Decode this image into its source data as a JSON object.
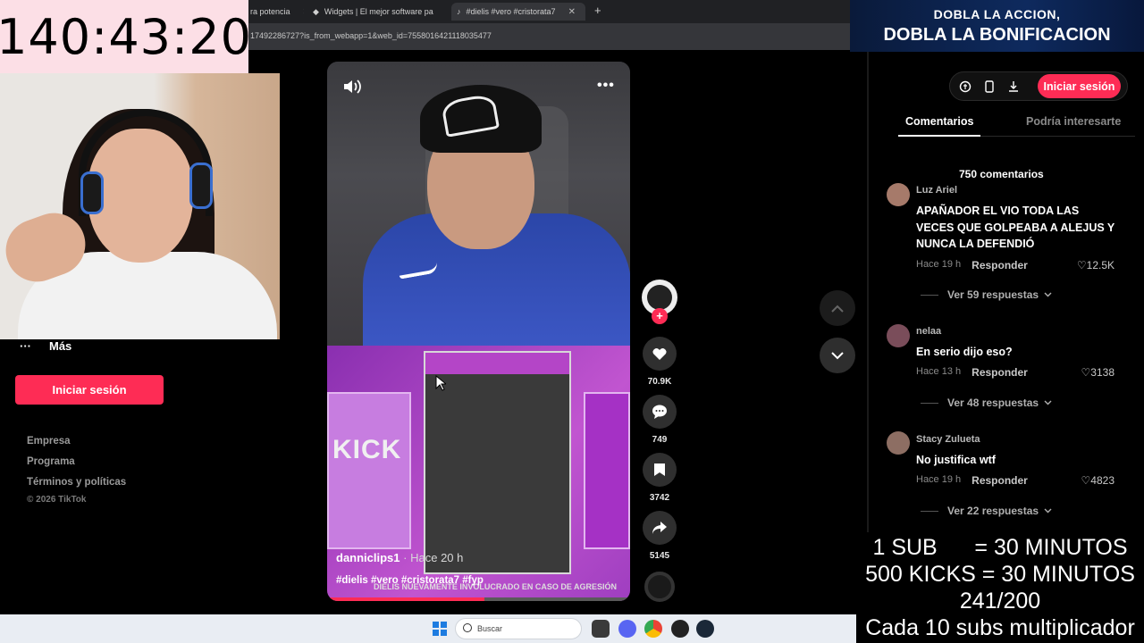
{
  "browser": {
    "tabs": [
      {
        "title": "ra potencia"
      },
      {
        "title": "Widgets | El mejor software pa"
      },
      {
        "title": "#dielis #vero #cristorata7"
      }
    ],
    "url": "17492286727?is_from_webapp=1&web_id=7558016421118035477"
  },
  "overlay": {
    "timer": "140:43:20",
    "promo_line1": "DOBLA LA ACCION,",
    "promo_line2": "DOBLA LA BONIFICACION",
    "subs_lines": [
      "1 SUB      = 30 MINUTOS",
      "500 KICKS = 30 MINUTOS",
      "241/200",
      "Cada 10 subs multiplicador"
    ]
  },
  "sidebar": {
    "more_icon": "···",
    "more_label": "Más",
    "login_label": "Iniciar sesión",
    "footer_links": [
      "Empresa",
      "Programa",
      "Términos y políticas"
    ],
    "copyright": "© 2026 TikTok"
  },
  "video": {
    "author": "danniclips1",
    "posted": "Hace 20 h",
    "hashtags": "#dielis #vero #cristorata7 #fyp",
    "banner": "DIELIS NUEVAMENTE INVOLUCRADO EN CASO DE AGRESIÓN",
    "kick_text": "KICK",
    "progress": 0.52,
    "likes": "70.9K",
    "comments": "749",
    "saves": "3742",
    "shares": "5145",
    "icons": {
      "volume": "speaker-icon",
      "more": "more-dots-icon"
    }
  },
  "right_panel": {
    "login_label": "Iniciar sesión",
    "tabs": [
      "Comentarios",
      "Podría interesarte"
    ],
    "comment_count": "750 comentarios",
    "reply_label": "Responder",
    "comments": [
      {
        "user": "Luz Ariel",
        "text": "APAÑADOR EL VIO TODA LAS VECES QUE GOLPEABA A ALEJUS Y NUNCA LA DEFENDIÓ",
        "time": "Hace 19 h",
        "likes": "12.5K",
        "more": "Ver 59 respuestas",
        "avatar_color": "#a67a6a"
      },
      {
        "user": "nelaa",
        "text": "En serio dijo eso?",
        "time": "Hace 13 h",
        "likes": "3138",
        "more": "Ver 48 respuestas",
        "avatar_color": "#7a4d5a"
      },
      {
        "user": "Stacy Zulueta",
        "text": "No justifica wtf",
        "time": "Hace 19 h",
        "likes": "4823",
        "more": "Ver 22 respuestas",
        "avatar_color": "#8d6e63"
      }
    ]
  },
  "taskbar": {
    "search_placeholder": "Buscar"
  },
  "colors": {
    "accent": "#fe2c55",
    "timer_bg": "#fcdfe6",
    "promo_bg": "#0e2a5e"
  }
}
